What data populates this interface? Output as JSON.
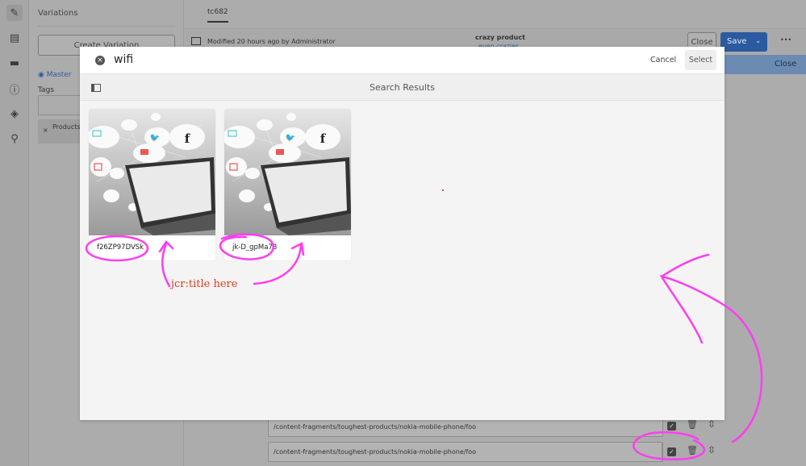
{
  "rail": {
    "icons": [
      "pencil-icon",
      "comment-icon",
      "folder-icon",
      "info-icon",
      "layers-icon",
      "search-references-icon"
    ]
  },
  "panel": {
    "title": "Variations",
    "create_variation": "Create Variation",
    "master": "Master",
    "tags_label": "Tags",
    "tag_chip": "Products Pump DC"
  },
  "main": {
    "tab": "tc682",
    "modified": "Modified 20 hours ago by Administrator",
    "product_title": "crazy product",
    "product_subtitle": "even crazier",
    "close": "Close",
    "save": "Save",
    "more": "•••",
    "banner_close": "Close",
    "rows": [
      "/content-fragments/toughest-products/nokia-mobile-phone/foo",
      "/content-fragments/toughest-products/nokia-mobile-phone/foo"
    ]
  },
  "modal": {
    "search_value": "wifi",
    "cancel": "Cancel",
    "select": "Select",
    "heading": "Search Results",
    "results": [
      {
        "title": "f26ZP97DVSk"
      },
      {
        "title": "jk-D_gpMa78"
      }
    ]
  },
  "annotation": {
    "text": "jcr:title here",
    "color": "#ff3df2",
    "text_color": "#e8391d"
  },
  "colors": {
    "accent": "#2b5aa0",
    "overlay": "#acacac"
  }
}
